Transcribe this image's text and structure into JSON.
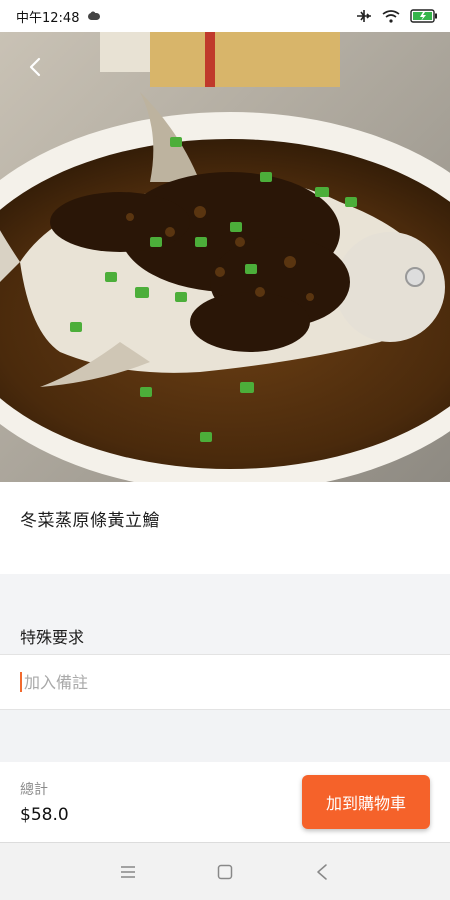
{
  "status_bar": {
    "time": "中午12:48",
    "icons": [
      "cloud-icon",
      "airplane-icon",
      "wifi-icon",
      "battery-charging-icon"
    ]
  },
  "hero": {
    "image_subject": "steamed pomfret fish with preserved vegetables and scallions",
    "back_icon": "chevron-left-icon"
  },
  "item": {
    "title": "冬菜蒸原條黃立鱠"
  },
  "special_request": {
    "label": "特殊要求",
    "placeholder": "加入備註",
    "value": ""
  },
  "footer": {
    "total_label": "總計",
    "total_value": "$58.0",
    "add_to_cart_label": "加到購物車",
    "accent_color": "#f5622a"
  },
  "nav_bar": {
    "icons": [
      "menu-icon",
      "home-square-icon",
      "back-triangle-icon"
    ]
  }
}
